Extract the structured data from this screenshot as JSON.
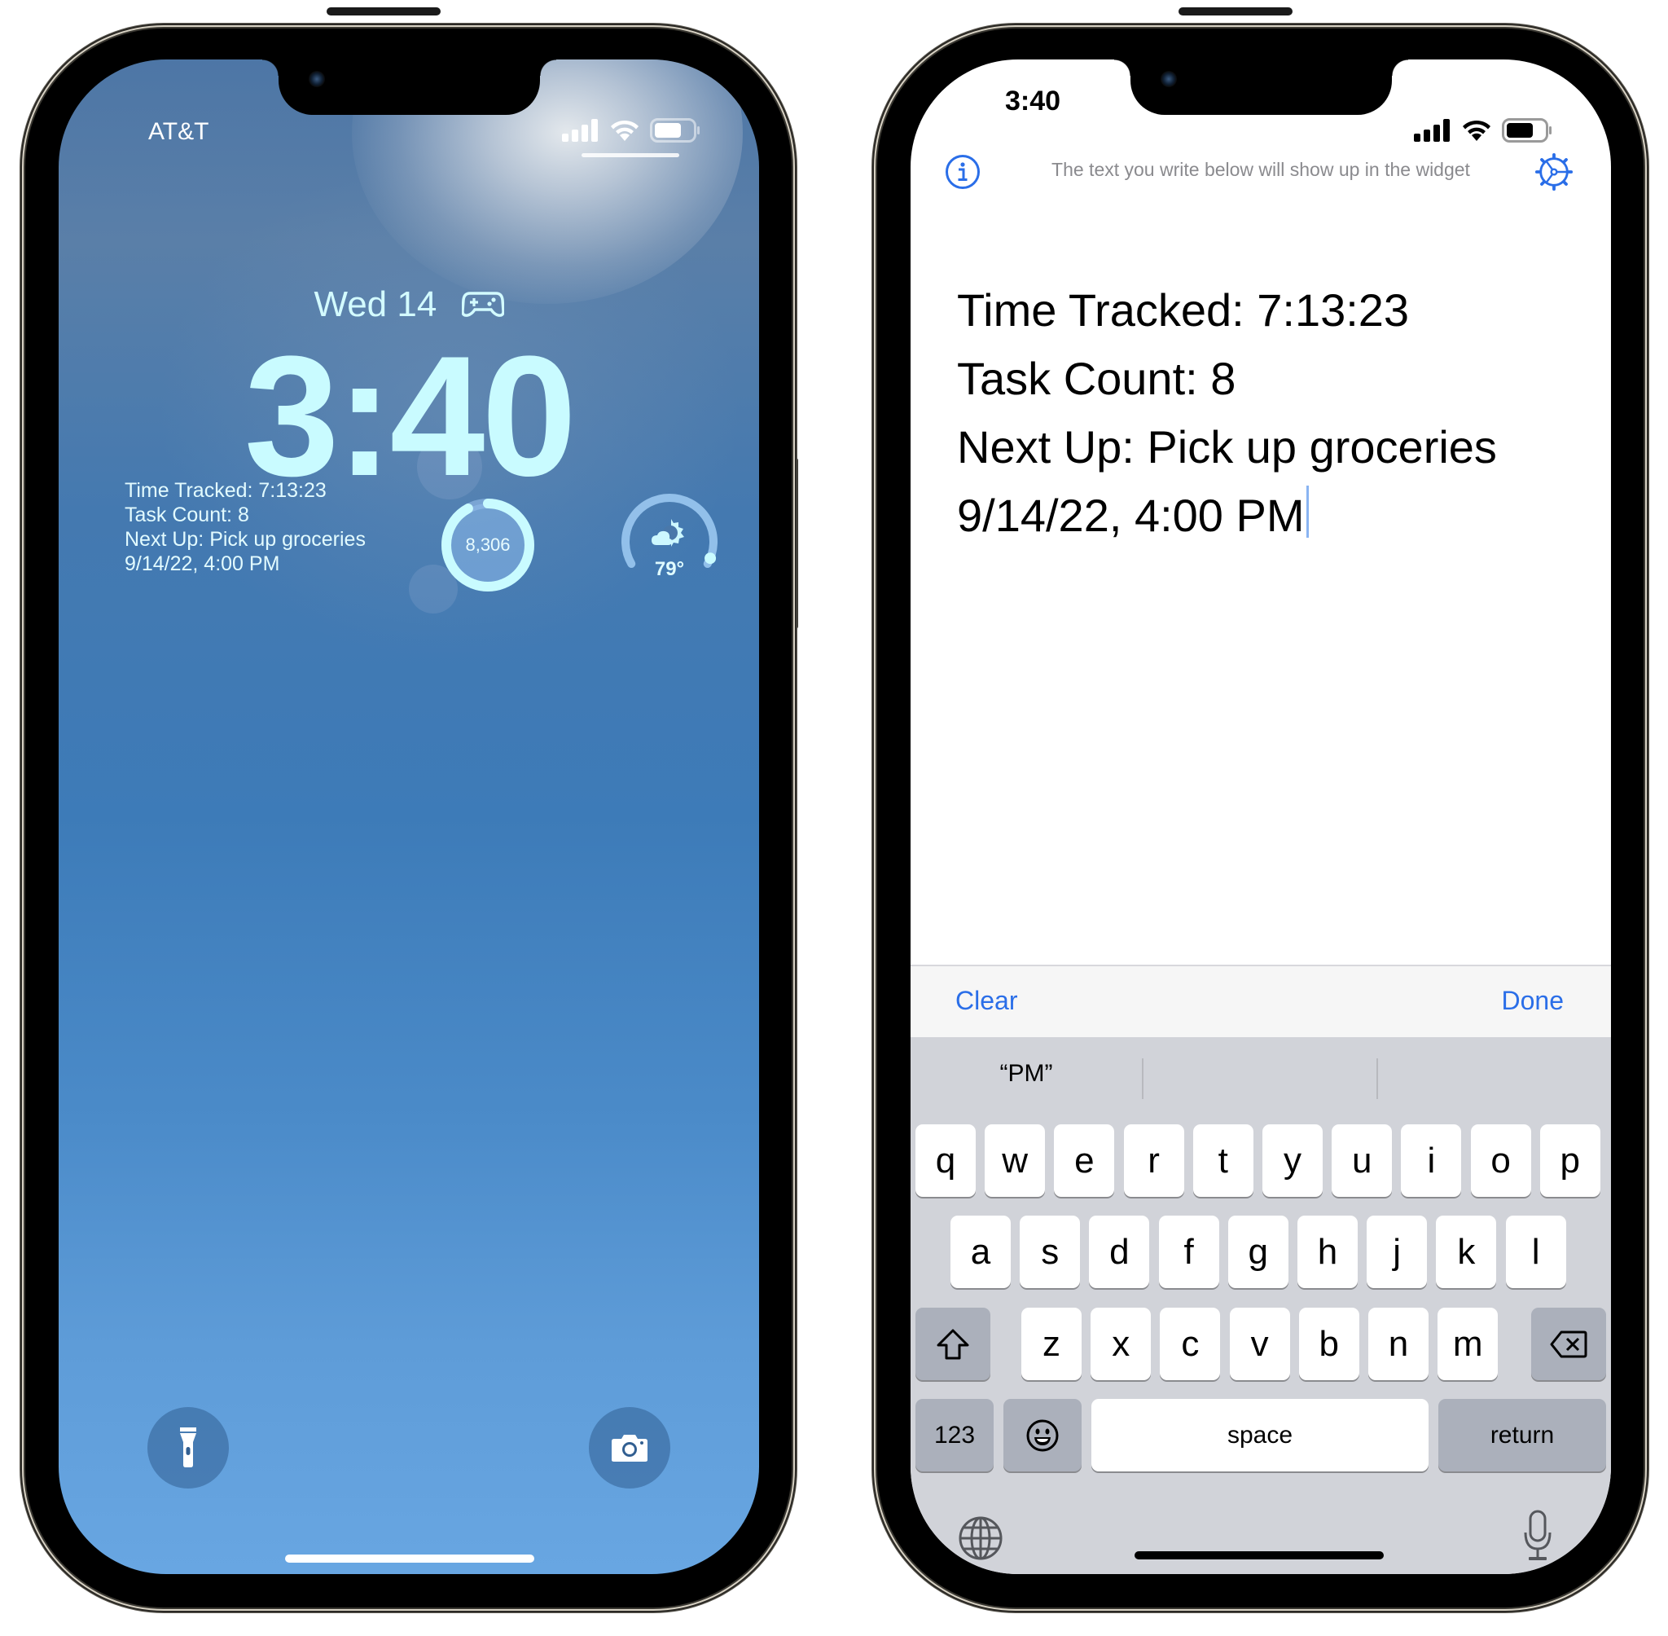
{
  "lock_screen": {
    "carrier": "AT&T",
    "date": "Wed 14",
    "date_icon": "game-controller-icon",
    "time": "3:40",
    "widget_lines": [
      "Time Tracked: 7:13:23",
      "Task Count: 8",
      "Next Up: Pick up groceries",
      "9/14/22, 4:00 PM"
    ],
    "steps_widget": {
      "value": "8,306",
      "progress": 0.92
    },
    "weather_widget": {
      "temperature": "79°",
      "icon": "partly-sunny-icon",
      "gauge_fraction": 0.8
    },
    "flashlight_icon": "flashlight-icon",
    "camera_icon": "camera-icon",
    "status_icons": [
      "cellular-signal-icon",
      "wifi-icon",
      "battery-icon"
    ]
  },
  "editor_screen": {
    "status_time": "3:40",
    "header_hint": "The text you write below will show up in the widget",
    "info_icon": "info-icon",
    "settings_icon": "gear-icon",
    "text_lines": [
      "Time Tracked: 7:13:23",
      "Task Count: 8",
      "Next Up: Pick up groceries",
      "9/14/22, 4:00 PM"
    ],
    "toolbar": {
      "clear_label": "Clear",
      "done_label": "Done"
    },
    "accent_color": "#2a6ee8",
    "keyboard": {
      "predictions": [
        "“PM”",
        "",
        ""
      ],
      "row1": [
        "q",
        "w",
        "e",
        "r",
        "t",
        "y",
        "u",
        "i",
        "o",
        "p"
      ],
      "row2": [
        "a",
        "s",
        "d",
        "f",
        "g",
        "h",
        "j",
        "k",
        "l"
      ],
      "row3": [
        "z",
        "x",
        "c",
        "v",
        "b",
        "n",
        "m"
      ],
      "numbers_label": "123",
      "space_label": "space",
      "return_label": "return"
    }
  }
}
